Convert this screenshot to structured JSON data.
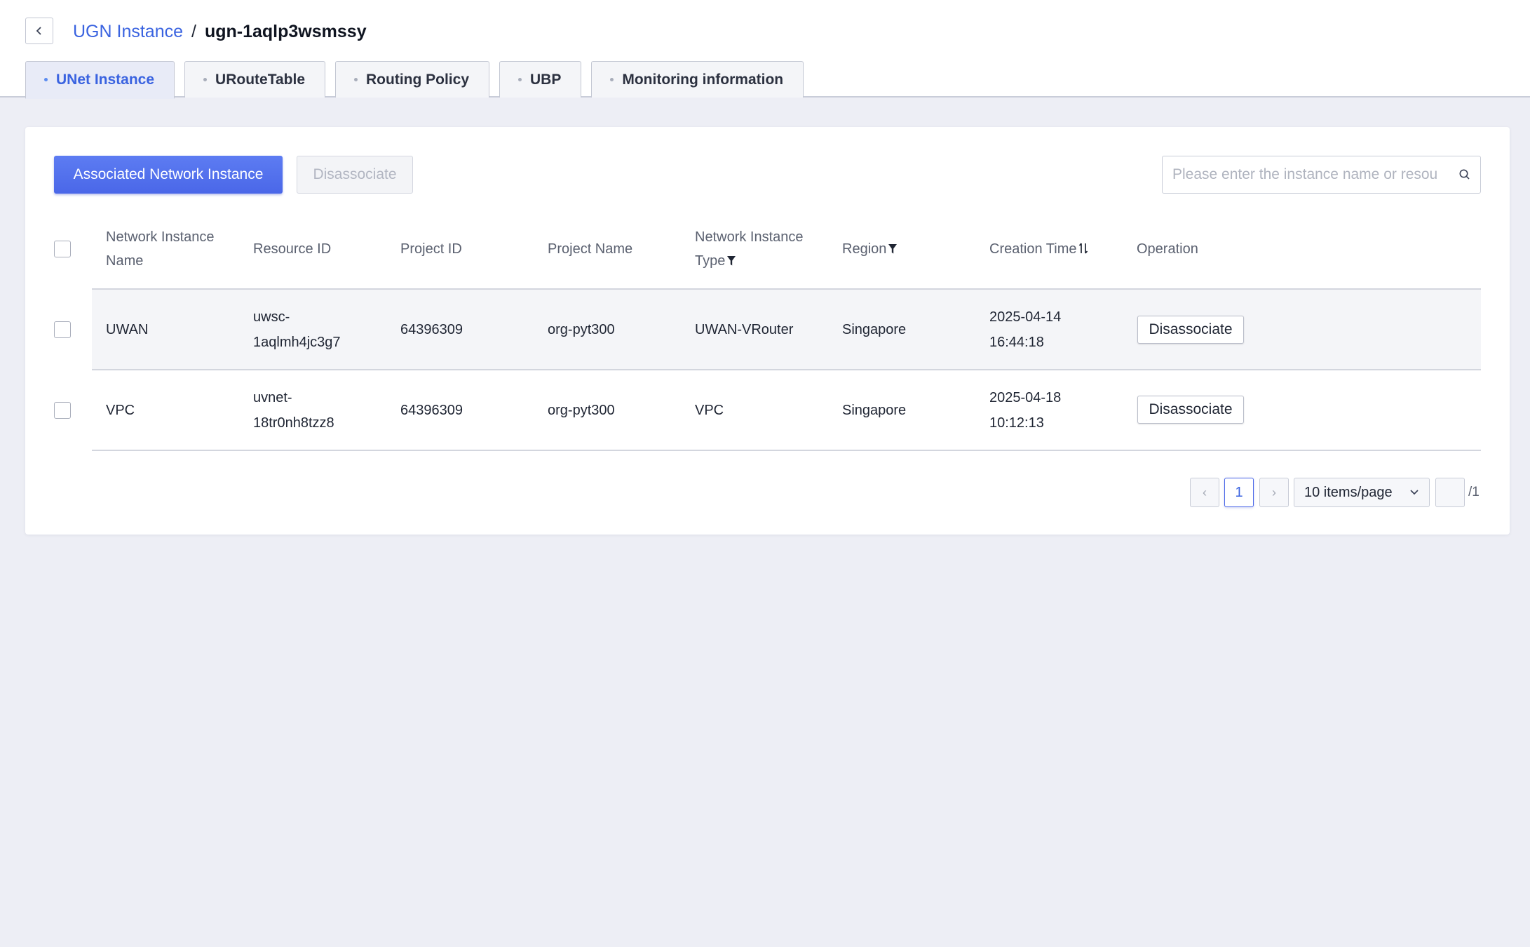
{
  "breadcrumb": {
    "parent": "UGN Instance",
    "separator": "/",
    "current": "ugn-1aqlp3wsmssy"
  },
  "tabs": [
    {
      "label": "UNet Instance",
      "active": true
    },
    {
      "label": "URouteTable",
      "active": false
    },
    {
      "label": "Routing Policy",
      "active": false
    },
    {
      "label": "UBP",
      "active": false
    },
    {
      "label": "Monitoring information",
      "active": false
    }
  ],
  "toolbar": {
    "primary_label": "Associated Network Instance",
    "disassociate_label": "Disassociate",
    "search_placeholder": "Please enter the instance name or resou"
  },
  "table": {
    "headers": {
      "name_line1": "Network Instance",
      "name_line2": "Name",
      "resource_id": "Resource ID",
      "project_id": "Project ID",
      "project_name": "Project Name",
      "type_line1": "Network Instance",
      "type_line2": "Type",
      "region": "Region",
      "creation_time": "Creation Time",
      "operation": "Operation"
    },
    "rows": [
      {
        "name": "UWAN",
        "resource_id_line1": "uwsc-",
        "resource_id_line2": "1aqlmh4jc3g7",
        "project_id": "64396309",
        "project_name": "org-pyt300",
        "type": "UWAN-VRouter",
        "region": "Singapore",
        "date": "2025-04-14",
        "time": "16:44:18",
        "action": "Disassociate"
      },
      {
        "name": "VPC",
        "resource_id_line1": "uvnet-",
        "resource_id_line2": "18tr0nh8tzz8",
        "project_id": "64396309",
        "project_name": "org-pyt300",
        "type": "VPC",
        "region": "Singapore",
        "date": "2025-04-18",
        "time": "10:12:13",
        "action": "Disassociate"
      }
    ]
  },
  "pagination": {
    "prev": "‹",
    "current_page": "1",
    "next": "›",
    "page_size": "10 items/page",
    "total_pages": "/1"
  },
  "colors": {
    "accent": "#3a63e0",
    "primary_button": "#4a67e8",
    "page_bg": "#edeef5"
  },
  "icons": [
    "back-chevron-icon",
    "search-icon",
    "filter-icon",
    "sort-icon",
    "chevron-down-icon"
  ]
}
